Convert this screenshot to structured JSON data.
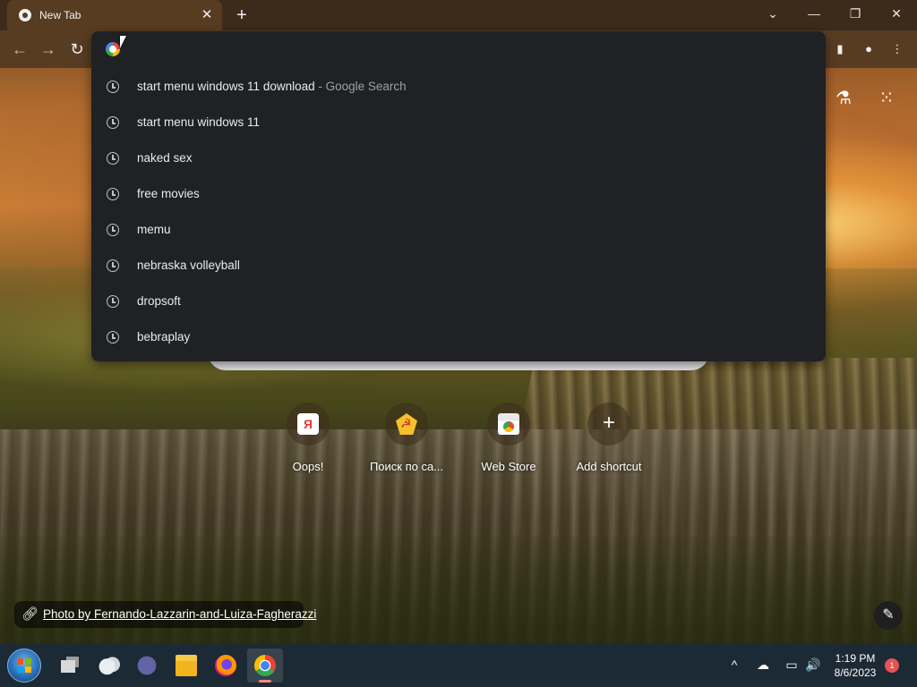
{
  "tab": {
    "title": "New Tab",
    "close_icon": "close-icon"
  },
  "window": {
    "new_tab_symbol": "+",
    "dropdown_symbol": "⌄",
    "minimize_symbol": "—",
    "restore_symbol": "❐",
    "close_symbol": "✕"
  },
  "toolbar": {
    "back_symbol": "←",
    "forward_symbol": "→",
    "reload_symbol": "↻",
    "sidepanel_symbol": "▮",
    "profile_symbol": "●",
    "menu_symbol": "⋮"
  },
  "omnibox": {
    "value": "",
    "placeholder": "",
    "suggestions": [
      {
        "text": "start menu windows 11 download",
        "suffix": " - Google Search"
      },
      {
        "text": "start menu windows 11",
        "suffix": ""
      },
      {
        "text": "naked sex",
        "suffix": ""
      },
      {
        "text": "free movies",
        "suffix": ""
      },
      {
        "text": "memu",
        "suffix": ""
      },
      {
        "text": "nebraska volleyball",
        "suffix": ""
      },
      {
        "text": "dropsoft",
        "suffix": ""
      },
      {
        "text": "bebraplay",
        "suffix": ""
      }
    ]
  },
  "ntp": {
    "labs_icon": "flask-icon",
    "apps_icon": "apps-grid-icon",
    "shortcuts": [
      {
        "label": "Oops!",
        "icon": "yandex-icon",
        "glyph": "Я"
      },
      {
        "label": "Поиск по са...",
        "icon": "ussr-emblem-icon",
        "glyph": ""
      },
      {
        "label": "Web Store",
        "icon": "web-store-icon",
        "glyph": ""
      },
      {
        "label": "Add shortcut",
        "icon": "plus-icon",
        "glyph": "+"
      }
    ],
    "photo_credit": "Photo by Fernando-Lazzarin-and-Luiza-Fagherazzi",
    "customize_symbol": "✎"
  },
  "taskbar": {
    "apps": [
      {
        "name": "task-view-icon",
        "active": false
      },
      {
        "name": "onedrive-icon",
        "active": false
      },
      {
        "name": "teams-meet-icon",
        "active": false
      },
      {
        "name": "file-explorer-icon",
        "active": false
      },
      {
        "name": "firefox-icon",
        "active": false
      },
      {
        "name": "chrome-icon",
        "active": true
      }
    ],
    "time": "1:19 PM",
    "date": "8/6/2023",
    "notification_count": "1",
    "tray_chevron": "^",
    "volume_symbol": "🔊"
  },
  "colors": {
    "titlebar": "#3c2a1a",
    "toolbar": "#583c22",
    "dropdown": "#202124",
    "taskbar": "#1c2a35"
  }
}
